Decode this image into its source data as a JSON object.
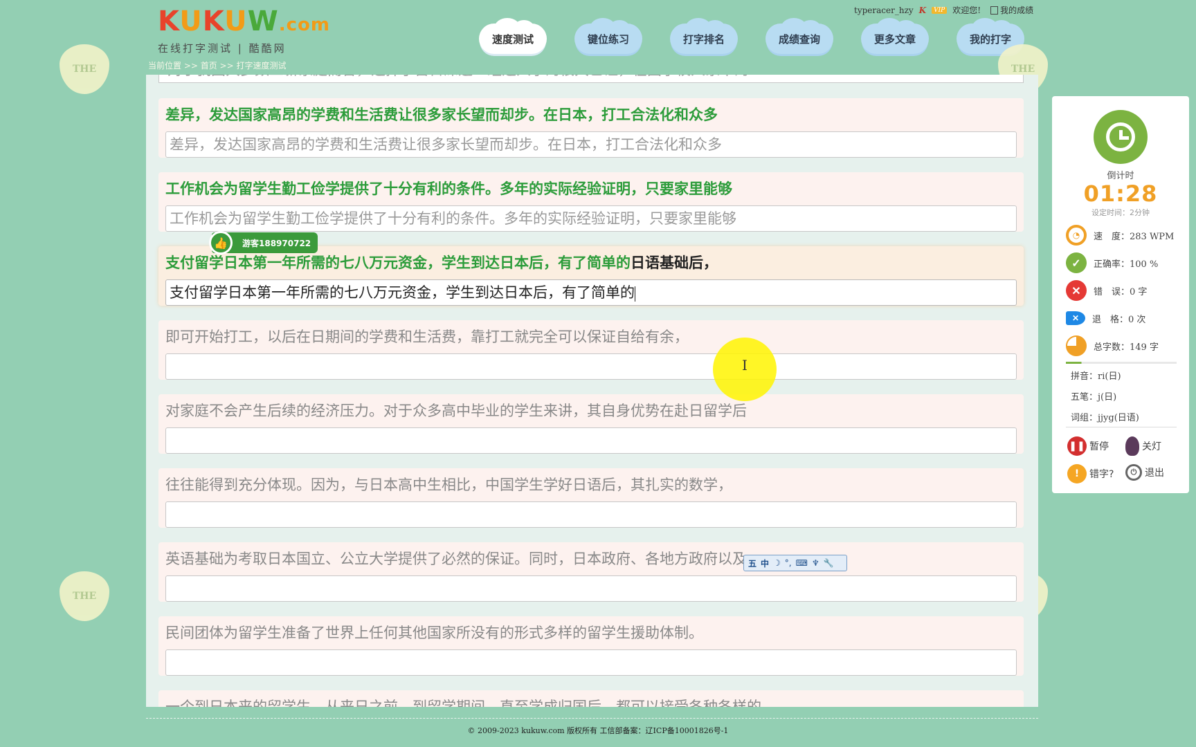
{
  "logo": {
    "letters": [
      "K",
      "U",
      "K",
      "U",
      "W"
    ],
    "suffix": ".com",
    "subtitle": "在线打字测试 | 酷酷网"
  },
  "topbar": {
    "username": "typeracer_hzy",
    "vip": "VIP",
    "welcome": "欢迎您!",
    "my_scores": "我的成绩"
  },
  "nav": [
    {
      "label": "速度测试",
      "active": true
    },
    {
      "label": "键位练习"
    },
    {
      "label": "打字排名"
    },
    {
      "label": "成绩查询"
    },
    {
      "label": "更多文章"
    },
    {
      "label": "我的打字"
    }
  ],
  "breadcrumb": "当前位置 >> 首页 >> 打字速度测试",
  "deco_text": "THE",
  "typing": {
    "cut_top_input": "对于我国大多数工薪家庭而言，选择了留日深造一经选人学的很大已证，在国学校人家中的",
    "rows": [
      {
        "source": "差异，发达国家高昂的学费和生活费让很多家长望而却步。在日本，打工合法化和众多",
        "input": "差异，发达国家高昂的学费和生活费让很多家长望而却步。在日本，打工合法化和众多",
        "state": "done"
      },
      {
        "source": "工作机会为留学生勤工俭学提供了十分有利的条件。多年的实际经验证明，只要家里能够",
        "input": "工作机会为留学生勤工俭学提供了十分有利的条件。多年的实际经验证明，只要家里能够",
        "state": "done"
      },
      {
        "source_typed": "支付留学日本第一年所需的七八万元资金，学生到达日本后，有了简单的",
        "source_rest": "日语基础后，",
        "input": "支付留学日本第一年所需的七八万元资金，学生到达日本后，有了简单的",
        "state": "active"
      },
      {
        "source": "即可开始打工，以后在日期间的学费和生活费，靠打工就完全可以保证自给有余，",
        "input": "",
        "state": "pending"
      },
      {
        "source": "对家庭不会产生后续的经济压力。对于众多高中毕业的学生来讲，其自身优势在赴日留学后",
        "input": "",
        "state": "pending"
      },
      {
        "source": "往往能得到充分体现。因为，与日本高中生相比，中国学生学好日语后，其扎实的数学，",
        "input": "",
        "state": "pending"
      },
      {
        "source": "英语基础为考取日本国立、公立大学提供了必然的保证。同时，日本政府、各地方政府以及",
        "input": "",
        "state": "pending"
      },
      {
        "source": "民间团体为留学生准备了世界上任何其他国家所没有的形式多样的留学生援助体制。",
        "input": "",
        "state": "pending"
      },
      {
        "source": "一个到日本来的留学生，从来日之前，到留学期间，直至学成归国后，都可以接受各种各样的",
        "input": "",
        "state": "pending"
      }
    ]
  },
  "badge": {
    "user": "游客188970722",
    "icon": "thumbs-up-icon"
  },
  "ime_toolbar": {
    "mode": "中",
    "items": [
      "五",
      "中",
      "☽",
      "°,",
      "⌨",
      "♆",
      "🔧"
    ]
  },
  "side": {
    "countdown_label": "倒计时",
    "countdown": "01:28",
    "setting": "设定时间：2分钟",
    "speed": "速　度：283 WPM",
    "accuracy": "正确率：100 %",
    "errors": "错　误：0 字",
    "backspace": "退　格：0 次",
    "total": "总字数：149 字",
    "progress": 0.14,
    "pinyin": "拼音：ri(日)",
    "wubi": "五笔：j(日)",
    "phrase": "词组：jjyg(日语)",
    "pause": "暂停",
    "lights_off": "关灯",
    "report_typo": "错字?",
    "exit": "退出"
  },
  "footer": "© 2009-2023 kukuw.com 版权所有 工信部备案：辽ICP备10001826号-1"
}
